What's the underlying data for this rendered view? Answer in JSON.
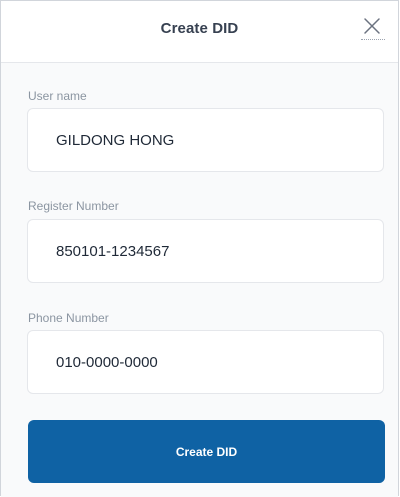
{
  "header": {
    "title": "Create DID",
    "close_icon": "close-icon"
  },
  "form": {
    "user_name": {
      "label": "User name",
      "value": "GILDONG HONG"
    },
    "register_number": {
      "label": "Register Number",
      "value": "850101-1234567"
    },
    "phone_number": {
      "label": "Phone Number",
      "value": "010-0000-0000"
    },
    "submit_label": "Create DID"
  },
  "colors": {
    "primary_button": "#0f62a4",
    "label_text": "#8b95a1",
    "field_border": "#e5e7eb",
    "body_background": "#f9fafb"
  }
}
